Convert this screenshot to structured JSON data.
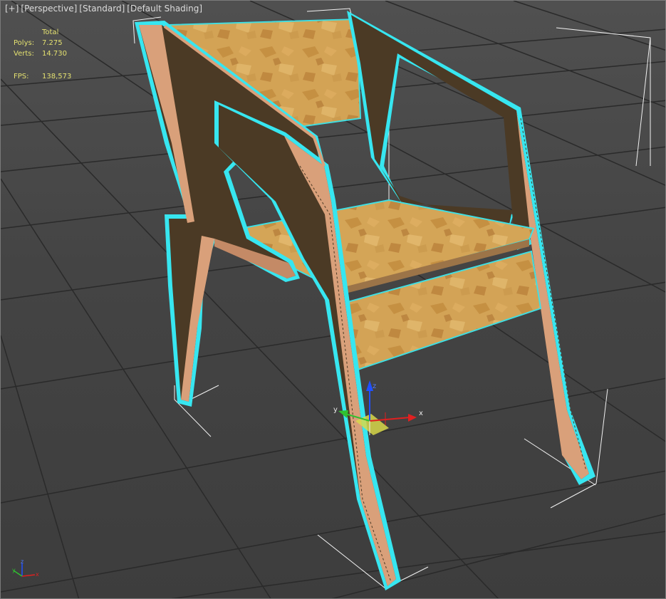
{
  "viewport": {
    "labels": {
      "plus": "[+]",
      "view": "[Perspective]",
      "mode": "[Standard]",
      "shading": "[Default Shading]"
    },
    "stats": {
      "header": "Total",
      "polys_label": "Polys:",
      "polys_value": "7.275",
      "verts_label": "Verts:",
      "verts_value": "14.730",
      "fps_label": "FPS:",
      "fps_value": "138,573"
    },
    "gizmo": {
      "x": "x",
      "y": "y",
      "z": "z"
    },
    "axis_tripod": {
      "x": "x",
      "y": "y",
      "z": "z"
    }
  },
  "colors": {
    "selection_outline": "#37e6f0",
    "frame_dark": "#4b3a25",
    "plywood_edge": "#d9a07a",
    "osb": "#d7a85a",
    "grid_line": "#2b2b2b",
    "stats_text": "#e3e070",
    "axis_x": "#e02020",
    "axis_y": "#30c030",
    "axis_z": "#2050ff"
  }
}
